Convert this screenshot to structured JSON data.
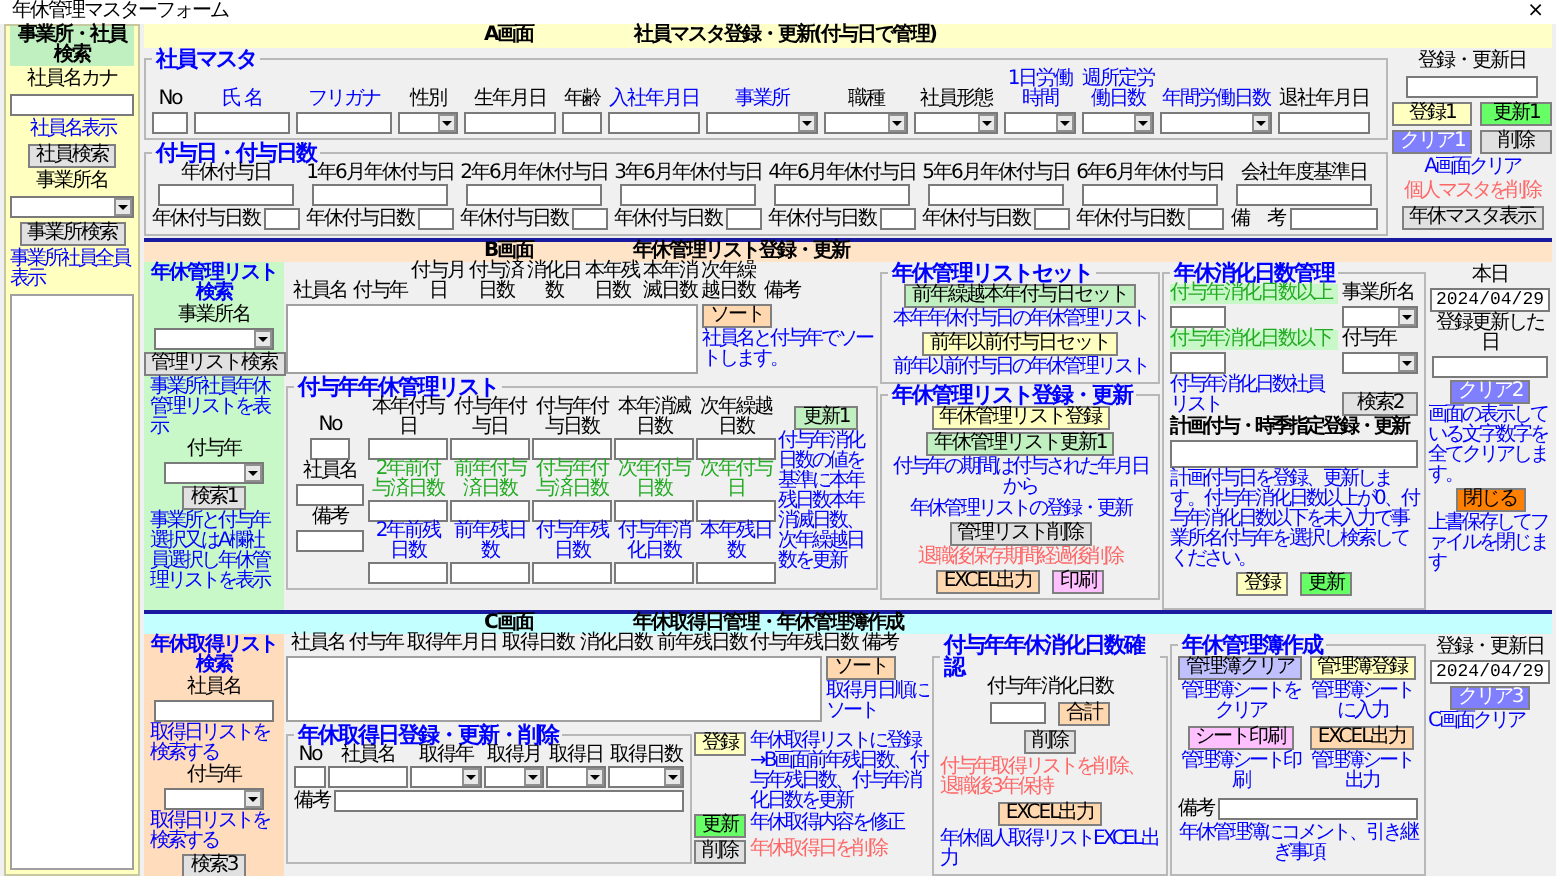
{
  "window": {
    "title": "年休管理マスターフォーム",
    "close": "×"
  },
  "sidebar": {
    "title": "事業所・社員検索",
    "kana_label": "社員名カナ",
    "kana_note": "社員名表示",
    "search_button": "社員検索",
    "office_label": "事業所名",
    "office_button": "事業所検索",
    "office_note": "事業所社員全員表示"
  },
  "screen_a": {
    "code": "A画面",
    "title": "社員マスタ登録・更新(付与日で管理)",
    "master": {
      "title": "社員マスタ",
      "fields": [
        {
          "label": "No",
          "kind": "input",
          "color": "#000000"
        },
        {
          "label": "氏 名",
          "kind": "input",
          "color": "#0000ff"
        },
        {
          "label": "フリガナ",
          "kind": "input",
          "color": "#0000ff"
        },
        {
          "label": "性別",
          "kind": "combo",
          "color": "#000000"
        },
        {
          "label": "生年月日",
          "kind": "input",
          "color": "#000000"
        },
        {
          "label": "年齢",
          "kind": "input",
          "color": "#000000"
        },
        {
          "label": "入社年月日",
          "kind": "input",
          "color": "#0000ff"
        },
        {
          "label": "事業所",
          "kind": "combo",
          "color": "#0000ff"
        },
        {
          "label": "職種",
          "kind": "combo",
          "color": "#000000"
        },
        {
          "label": "社員形態",
          "kind": "combo",
          "color": "#000000"
        },
        {
          "label": "1日労働時間",
          "kind": "combo",
          "color": "#0000ff"
        },
        {
          "label": "週所定労働日数",
          "kind": "combo",
          "color": "#0000ff"
        },
        {
          "label": "年間労働日数",
          "kind": "combo",
          "color": "#0000ff"
        },
        {
          "label": "退社年月日",
          "kind": "input",
          "color": "#000000"
        }
      ]
    },
    "grants": {
      "title": "付与日・付与日数",
      "dates": [
        "年休付与日",
        "1年6月年休付与日",
        "2年6月年休付与日",
        "3年6月年休付与日",
        "4年6月年休付与日",
        "5年6月年休付与日",
        "6年6月年休付与日",
        "会社年度基準日"
      ],
      "days": [
        "年休付与日数",
        "年休付与日数",
        "年休付与日数",
        "年休付与日数",
        "年休付与日数",
        "年休付与日数",
        "年休付与日数"
      ],
      "remarks": "備　考"
    },
    "actions": {
      "date_label": "登録・更新日",
      "buttons": [
        {
          "label": "登録1",
          "color": "#ffffc0"
        },
        {
          "label": "更新1",
          "color": "#66ff66"
        },
        {
          "label": "クリア1",
          "color": "#8080ff"
        },
        {
          "label": "削除",
          "color": "#e0e0e0"
        }
      ],
      "notes": [
        {
          "text": "A画面クリア",
          "color": "#0000ff"
        },
        {
          "text": "個人マスタを削除",
          "color": "#ff6666"
        }
      ],
      "show_button": "年休マスタ表示"
    }
  },
  "screen_b": {
    "code": "B画面",
    "title": "年休管理リスト登録・更新",
    "search": {
      "title": "年休管理リスト検索",
      "office_label": "事業所名",
      "list_button": "管理リスト検索",
      "list_note": "事業所社員年休管理リストを表示",
      "year_label": "付与年",
      "search_button": "検索1",
      "search_note": "事業所と付与年選択又はA欄社員選択し年休管理リストを表示"
    },
    "list": {
      "columns": [
        "社員名",
        "付与年",
        "付与月日",
        "付与済日数",
        "消化日数",
        "本年残日数",
        "本年消滅日数",
        "次年繰越日数",
        "備考"
      ],
      "sort_button": {
        "label": "ソート",
        "color": "#ffd8b0"
      },
      "sort_note": "社員名と付与年でソートします。"
    },
    "detail": {
      "title": "付与年年休管理リスト",
      "no_label": "No",
      "name_label": "社員名",
      "remarks_label": "備考",
      "fields": [
        {
          "label": "本年付与日",
          "color": "#000000"
        },
        {
          "label": "付与年付与日",
          "color": "#000000"
        },
        {
          "label": "付与年付与日数",
          "color": "#000000"
        },
        {
          "label": "本年消滅日数",
          "color": "#000000"
        },
        {
          "label": "次年繰越日数",
          "color": "#000000"
        },
        {
          "label": "2年前付与済日数",
          "color": "#22aa22"
        },
        {
          "label": "前年付与済日数",
          "color": "#22aa22"
        },
        {
          "label": "付与年付与済日数",
          "color": "#22aa22"
        },
        {
          "label": "次年付与日数",
          "color": "#22aa22"
        },
        {
          "label": "次年付与日",
          "color": "#22aa22"
        },
        {
          "label": "2年前残日数",
          "color": "#0000ff"
        },
        {
          "label": "前年残日数",
          "color": "#0000ff"
        },
        {
          "label": "付与年残日数",
          "color": "#0000ff"
        },
        {
          "label": "付与年消化日数",
          "color": "#0000ff"
        },
        {
          "label": "本年残日数",
          "color": "#0000ff"
        }
      ],
      "update_button": {
        "label": "更新1",
        "color": "#c0f0c0"
      },
      "update_note": "付与年消化日数の値を基準に本年残日数本年消滅日数、次年繰越日数を更新"
    },
    "list_set": {
      "title": "年休管理リストセット",
      "items": [
        {
          "button": {
            "label": "前年繰越本年付与日セット",
            "color": "#c0f0c0"
          },
          "note": "本年年休付与日の年休管理リスト"
        },
        {
          "button": {
            "label": "前年以前付与日セット",
            "color": "#ffffc0"
          },
          "note": "前年以前付与日の年休管理リスト"
        }
      ]
    },
    "list_edit": {
      "title": "年休管理リスト登録・更新",
      "register_button": {
        "label": "年休管理リスト登録",
        "color": "#ffffc0"
      },
      "update_button": {
        "label": "年休管理リスト更新1",
        "color": "#c0f0c0"
      },
      "period_note": "付与年の期間は付与された年月日から",
      "edit_note": "年休管理リストの登録・更新",
      "delete_button": {
        "label": "管理リスト削除",
        "color": "#e0e0e0"
      },
      "delete_note": "退職後保存期間経過後削除",
      "excel_button": {
        "label": "EXCEL出力",
        "color": "#ffd8b0"
      },
      "print_button": {
        "label": "印刷",
        "color": "#ffc0ff"
      }
    },
    "usage": {
      "title": "年休消化日数管理",
      "min_label": "付与年消化日数以上",
      "office_label": "事業所名",
      "max_label": "付与年消化日数以下",
      "year_label": "付与年",
      "search_note": "付与年消化日数社員リスト",
      "search_button": "検索2",
      "plan_title": "計画付与・時季指定登録・更新",
      "plan_note": "計画付与日を登録、更新します。付与年消化日数以上が0、付与年消化日数以下を未入力で事業所名付与年を選択し検索してください。",
      "register_button": {
        "label": "登録",
        "color": "#ffffc0"
      },
      "update_button": {
        "label": "更新",
        "color": "#66ff66"
      }
    },
    "side": {
      "today_label": "本日",
      "today": "2024/04/29",
      "updated_label": "登録更新した日",
      "clear_button": {
        "label": "クリア2",
        "color": "#8080ff"
      },
      "clear_note": "画面の表示している文字数字を全てクリアします。",
      "close_button": {
        "label": "閉じる",
        "color": "#ff8000"
      },
      "close_note": "上書保存してファイルを閉じます"
    }
  },
  "screen_c": {
    "code": "C画面",
    "title": "年休取得日管理・年休管理簿作成",
    "search": {
      "title": "年休取得リスト検索",
      "name_label": "社員名",
      "name_note": "取得日リストを検索する",
      "year_label": "付与年",
      "year_note": "取得日リストを検索する",
      "search_button": "検索3"
    },
    "list": {
      "columns": [
        "社員名",
        "付与年",
        "取得年月日",
        "取得日数",
        "消化日数",
        "前年残日数",
        "付与年残日数",
        "備考"
      ],
      "sort_button": {
        "label": "ソート",
        "color": "#ffd8b0"
      },
      "sort_note": "取得月日順にソート"
    },
    "entry": {
      "title": "年休取得日登録・更新・削除",
      "fields": [
        {
          "label": "No",
          "kind": "input"
        },
        {
          "label": "社員名",
          "kind": "input"
        },
        {
          "label": "取得年",
          "kind": "combo"
        },
        {
          "label": "取得月",
          "kind": "combo"
        },
        {
          "label": "取得日",
          "kind": "combo"
        },
        {
          "label": "取得日数",
          "kind": "combo"
        }
      ],
      "remarks_label": "備考"
    },
    "actions": [
      {
        "button": {
          "label": "登録",
          "color": "#ffffc0"
        },
        "note": {
          "text": "年休取得リストに登録→B画面前年残日数、付与年残日数、付与年消化日数を更新",
          "color": "#0000ff"
        }
      },
      {
        "button": {
          "label": "更新",
          "color": "#66ff66"
        },
        "note": {
          "text": "年休取得内容を修正",
          "color": "#0000ff"
        }
      },
      {
        "button": {
          "label": "削除",
          "color": "#e0e0e0"
        },
        "note": {
          "text": "年休取得日を削除",
          "color": "#ff6666"
        }
      }
    ],
    "usage_check": {
      "title": "付与年年休消化日数確認",
      "label": "付与年消化日数",
      "total_button": {
        "label": "合計",
        "color": "#ffd8b0"
      },
      "delete_button": {
        "label": "削除",
        "color": "#e0e0e0"
      },
      "delete_note": "付与年取得リストを削除、退職後3年保持",
      "excel_button": {
        "label": "EXCEL出力",
        "color": "#ffd8b0"
      },
      "excel_note": "年休個人取得リストEXCEL出力"
    },
    "ledger": {
      "title": "年休管理簿作成",
      "items": [
        {
          "button": {
            "label": "管理簿クリア",
            "color": "#c0c0ff"
          },
          "note": "管理簿シートをクリア"
        },
        {
          "button": {
            "label": "管理簿登録",
            "color": "#ffffc0"
          },
          "note": "管理簿シートに入力"
        },
        {
          "button": {
            "label": "シート印刷",
            "color": "#ffc0ff"
          },
          "note": "管理簿シート印刷"
        },
        {
          "button": {
            "label": "EXCEL出力",
            "color": "#ffd8b0"
          },
          "note": "管理簿シート出力"
        }
      ],
      "remarks_label": "備考",
      "remarks_note": "年休管理簿にコメント、引き継ぎ事項"
    },
    "side": {
      "date_label": "登録・更新日",
      "date": "2024/04/29",
      "clear_button": {
        "label": "クリア3",
        "color": "#8080ff"
      },
      "clear_note": "C画面クリア"
    }
  }
}
